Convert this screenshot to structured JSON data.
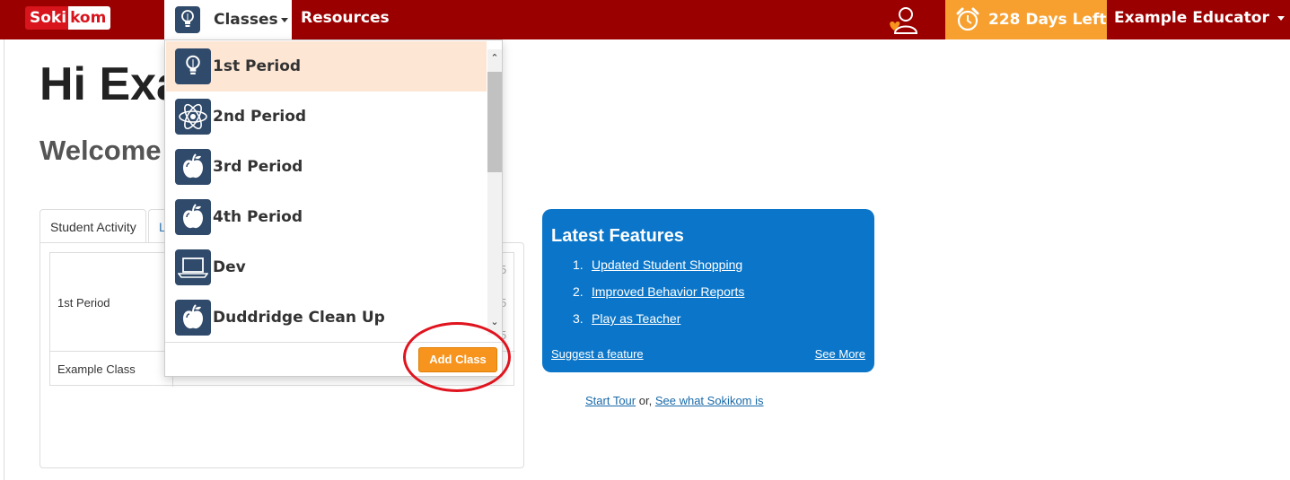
{
  "nav": {
    "logo_left": "Soki",
    "logo_right": "kom",
    "classes_label": "Classes",
    "resources_label": "Resources",
    "days_left": "228 Days Left",
    "user_name": "Example Educator"
  },
  "main": {
    "greeting": "Hi Exa",
    "welcome": "Welcome",
    "tabs": [
      {
        "label": "Student Activity"
      },
      {
        "label": "L"
      }
    ],
    "rows": [
      {
        "label": "1st Period"
      },
      {
        "label": "Example Class"
      }
    ],
    "fragments": [
      "5",
      "5",
      "5"
    ]
  },
  "dropdown": {
    "items": [
      {
        "name": "1st Period",
        "icon": "lightbulb-icon",
        "active": true
      },
      {
        "name": "2nd Period",
        "icon": "atom-icon"
      },
      {
        "name": "3rd Period",
        "icon": "apple-icon"
      },
      {
        "name": "4th Period",
        "icon": "apple-icon"
      },
      {
        "name": "Dev",
        "icon": "laptop-icon"
      },
      {
        "name": "Duddridge Clean Up",
        "icon": "apple-icon"
      }
    ],
    "add_class_label": "Add Class"
  },
  "features": {
    "title": "Latest Features",
    "items": [
      {
        "num": "1.",
        "text": "Updated Student Shopping"
      },
      {
        "num": "2.",
        "text": "Improved Behavior Reports"
      },
      {
        "num": "3.",
        "text": "Play as Teacher"
      }
    ],
    "suggest": "Suggest a feature",
    "see_more": "See More"
  },
  "tour": {
    "start": "Start Tour",
    "or": "or,",
    "what": "See what Sokikom is"
  },
  "colors": {
    "nav_bg": "#9b0000",
    "days_bg": "#f7a030",
    "features_bg": "#0b76c9",
    "add_class_bg": "#f7941d",
    "active_item_bg": "#fde6d4",
    "annotation_circle": "#e0141e"
  }
}
